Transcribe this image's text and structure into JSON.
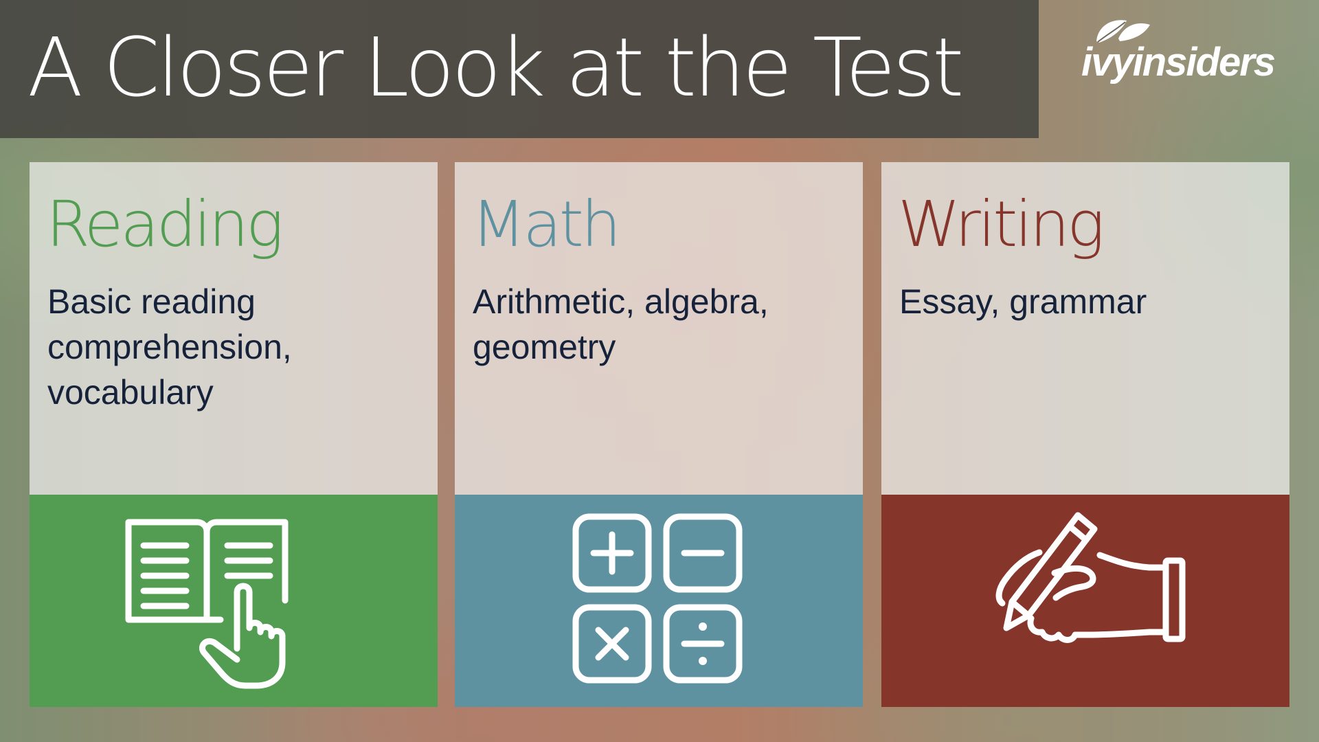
{
  "header": {
    "title": "A Closer Look at the Test",
    "logo_text": "ivyinsiders"
  },
  "sections": [
    {
      "heading": "Reading",
      "description": "Basic reading comprehension, vocabulary",
      "accent_color": "#529d52",
      "icon": "open-book-pointer-icon"
    },
    {
      "heading": "Math",
      "description": "Arithmetic, algebra, geometry",
      "accent_color": "#5f92a0",
      "icon": "calculator-operators-icon"
    },
    {
      "heading": "Writing",
      "description": "Essay, grammar",
      "accent_color": "#86352b",
      "icon": "hand-writing-pencil-icon"
    }
  ]
}
